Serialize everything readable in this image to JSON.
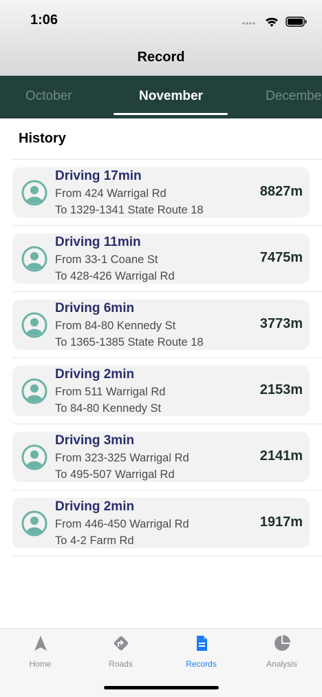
{
  "status": {
    "time": "1:06"
  },
  "nav": {
    "title": "Record"
  },
  "months": {
    "prev": "October",
    "current": "November",
    "next": "December"
  },
  "history": {
    "title": "History",
    "trips": [
      {
        "title": "Driving 17min",
        "from": "From 424 Warrigal Rd",
        "to": "To 1329-1341 State Route 18",
        "distance": "8827m"
      },
      {
        "title": "Driving 11min",
        "from": "From 33-1 Coane St",
        "to": "To 428-426 Warrigal Rd",
        "distance": "7475m"
      },
      {
        "title": "Driving 6min",
        "from": "From 84-80 Kennedy St",
        "to": "To 1365-1385 State Route 18",
        "distance": "3773m"
      },
      {
        "title": "Driving 2min",
        "from": "From 511 Warrigal Rd",
        "to": "To 84-80 Kennedy St",
        "distance": "2153m"
      },
      {
        "title": "Driving 3min",
        "from": "From 323-325 Warrigal Rd",
        "to": "To 495-507 Warrigal Rd",
        "distance": "2141m"
      },
      {
        "title": "Driving 2min",
        "from": "From 446-450 Warrigal Rd",
        "to": "To 4-2 Farm Rd",
        "distance": "1917m"
      }
    ]
  },
  "tabbar": {
    "items": [
      {
        "label": "Home",
        "icon": "navigation-arrow-icon"
      },
      {
        "label": "Roads",
        "icon": "road-sign-icon"
      },
      {
        "label": "Records",
        "icon": "document-icon"
      },
      {
        "label": "Analysis",
        "icon": "pie-chart-icon"
      }
    ],
    "active_color": "#1a7cf5",
    "inactive_color": "#8e8e93"
  },
  "colors": {
    "month_bar": "#23413b",
    "trip_title": "#2a2d6e",
    "avatar": "#6bb3a6"
  }
}
